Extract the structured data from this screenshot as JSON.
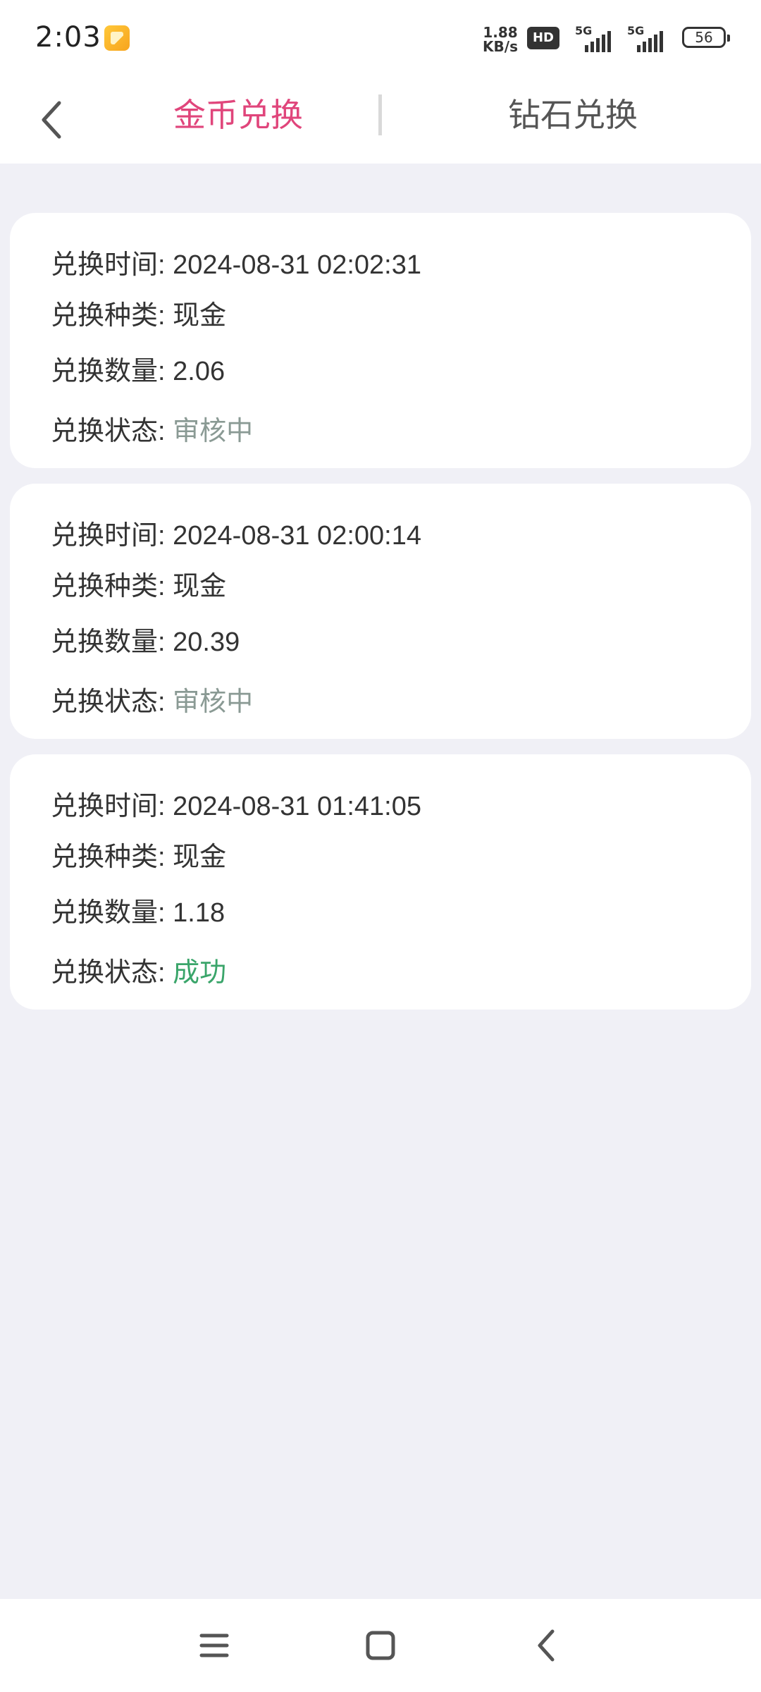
{
  "status_bar": {
    "time": "2:03",
    "net_speed_value": "1.88",
    "net_speed_unit": "KB/s",
    "hd_label": "HD",
    "signal1_label": "5G",
    "signal2_label": "5G",
    "battery": "56"
  },
  "header": {
    "tabs": [
      {
        "label": "金币兑换",
        "active": true
      },
      {
        "label": "钻石兑换",
        "active": false
      }
    ],
    "accent_color": "#e0457b"
  },
  "records": [
    {
      "time_label": "兑换时间: ",
      "time": "2024-08-31 02:02:31",
      "type_label": "兑换种类: ",
      "type": "现金",
      "amount_label": "兑换数量: ",
      "amount": "2.06",
      "status_label": "兑换状态: ",
      "status": "审核中"
    },
    {
      "time_label": "兑换时间: ",
      "time": "2024-08-31 02:00:14",
      "type_label": "兑换种类: ",
      "type": "现金",
      "amount_label": "兑换数量: ",
      "amount": "20.39",
      "status_label": "兑换状态: ",
      "status": "审核中"
    },
    {
      "time_label": "兑换时间: ",
      "time": "2024-08-31 01:41:05",
      "type_label": "兑换种类: ",
      "type": "现金",
      "amount_label": "兑换数量: ",
      "amount": "1.18",
      "status_label": "兑换状态: ",
      "status": "成功"
    }
  ],
  "colors": {
    "status_pending": "#8a9a94",
    "status_success": "#3aa56a",
    "background": "#f0f0f6"
  },
  "nav_bar": {
    "icons": [
      "menu-icon",
      "home-icon",
      "back-icon"
    ]
  }
}
